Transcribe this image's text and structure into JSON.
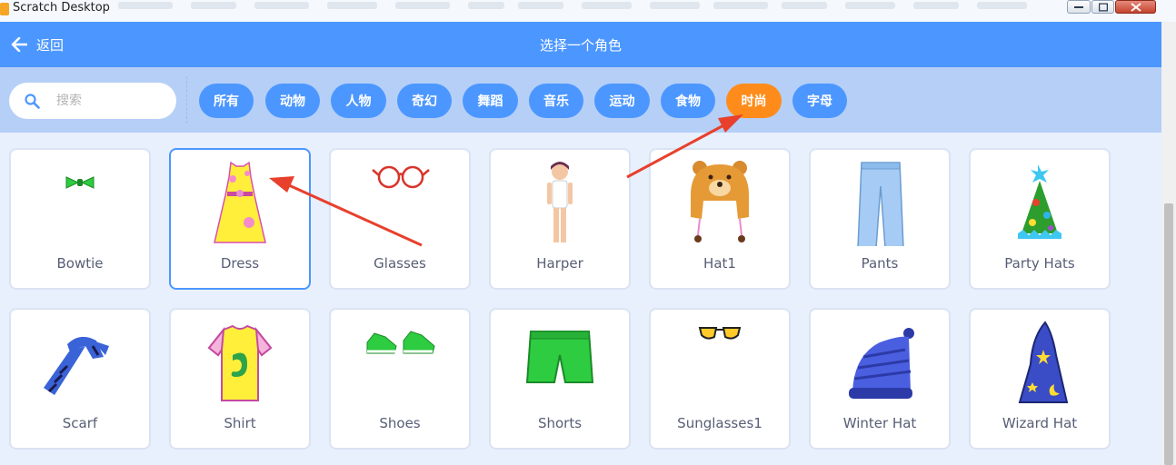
{
  "window": {
    "title": "Scratch Desktop"
  },
  "header": {
    "back_label": "返回",
    "title": "选择一个角色"
  },
  "search": {
    "placeholder": "搜索",
    "value": ""
  },
  "tags": [
    {
      "label": "所有",
      "active": false
    },
    {
      "label": "动物",
      "active": false
    },
    {
      "label": "人物",
      "active": false
    },
    {
      "label": "奇幻",
      "active": false
    },
    {
      "label": "舞蹈",
      "active": false
    },
    {
      "label": "音乐",
      "active": false
    },
    {
      "label": "运动",
      "active": false
    },
    {
      "label": "食物",
      "active": false
    },
    {
      "label": "时尚",
      "active": true
    },
    {
      "label": "字母",
      "active": false
    }
  ],
  "sprites": [
    {
      "name": "Bowtie",
      "icon": "bowtie-icon"
    },
    {
      "name": "Dress",
      "icon": "dress-icon",
      "selected": true
    },
    {
      "name": "Glasses",
      "icon": "glasses-icon"
    },
    {
      "name": "Harper",
      "icon": "harper-icon"
    },
    {
      "name": "Hat1",
      "icon": "bear-hat-icon"
    },
    {
      "name": "Pants",
      "icon": "pants-icon"
    },
    {
      "name": "Party Hats",
      "icon": "party-hat-icon"
    },
    {
      "name": "Scarf",
      "icon": "scarf-icon"
    },
    {
      "name": "Shirt",
      "icon": "shirt-icon"
    },
    {
      "name": "Shoes",
      "icon": "shoes-icon"
    },
    {
      "name": "Shorts",
      "icon": "shorts-icon"
    },
    {
      "name": "Sunglasses1",
      "icon": "sunglasses-icon"
    },
    {
      "name": "Winter Hat",
      "icon": "winter-hat-icon"
    },
    {
      "name": "Wizard Hat",
      "icon": "wizard-hat-icon"
    }
  ],
  "colors": {
    "header": "#4c97ff",
    "toolbar": "#b5cff7",
    "active_tag": "#ff8c1a",
    "annotation_arrow": "#e8402c"
  }
}
